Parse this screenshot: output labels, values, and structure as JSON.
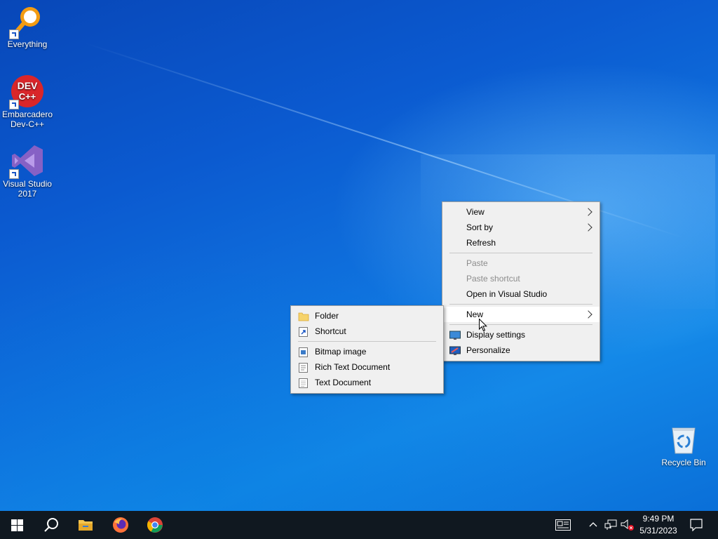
{
  "desktop_icons": [
    {
      "label": "Everything",
      "icon": "everything-search-icon"
    },
    {
      "label": "Embarcadero Dev-C++",
      "icon": "devcpp-icon",
      "badge": "DEV C++"
    },
    {
      "label": "Visual Studio 2017",
      "icon": "visual-studio-icon"
    },
    {
      "label": "Recycle Bin",
      "icon": "recycle-bin-icon"
    }
  ],
  "context_menu": {
    "items": [
      {
        "label": "View",
        "submenu": true
      },
      {
        "label": "Sort by",
        "submenu": true
      },
      {
        "label": "Refresh"
      },
      {
        "label": "Paste",
        "disabled": true
      },
      {
        "label": "Paste shortcut",
        "disabled": true
      },
      {
        "label": "Open in Visual Studio"
      },
      {
        "label": "New",
        "submenu": true,
        "highlighted": true
      },
      {
        "label": "Display settings",
        "icon": "display-icon"
      },
      {
        "label": "Personalize",
        "icon": "personalize-icon"
      }
    ]
  },
  "new_submenu": {
    "items": [
      {
        "label": "Folder",
        "icon": "folder-icon"
      },
      {
        "label": "Shortcut",
        "icon": "shortcut-icon"
      },
      {
        "label": "Bitmap image",
        "icon": "bitmap-icon"
      },
      {
        "label": "Rich Text Document",
        "icon": "rich-text-icon"
      },
      {
        "label": "Text Document",
        "icon": "text-document-icon"
      }
    ]
  },
  "taskbar": {
    "pinned": [
      "start-icon",
      "search-icon",
      "file-explorer-icon",
      "firefox-icon",
      "chrome-icon"
    ],
    "tray_icons": [
      "news-icon",
      "chevron-up-icon",
      "network-icon",
      "volume-muted-icon",
      "notification-icon"
    ],
    "time": "9:49 PM",
    "date": "5/31/2023"
  },
  "colors": {
    "taskbar_bg": "#101820",
    "menu_bg": "#f0f0f0",
    "desktop_blue": "#0b5ad0"
  }
}
